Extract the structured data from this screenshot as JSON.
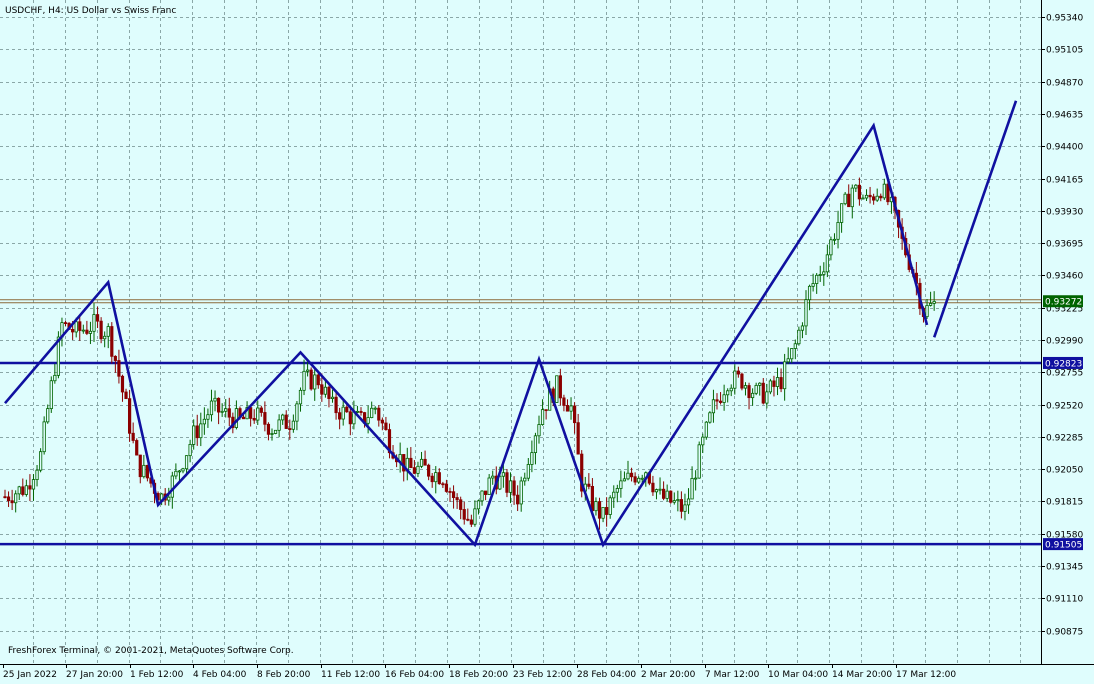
{
  "header": {
    "title": "USDCHF, H4:  US Dollar vs Swiss Franc"
  },
  "footer": {
    "copyright": "FreshForex Terminal, © 2001-2021, MetaQuotes Software Corp."
  },
  "colors": {
    "background": "#dffdfd",
    "grid": "#8aa7a7",
    "bull": "#006400",
    "bear": "#8b0000",
    "line": "#1010a0",
    "price_line": "#8b6a3a",
    "current_badge": "#006400",
    "level_badge": "#1010a0"
  },
  "chart_data": {
    "type": "candlestick",
    "symbol": "USDCHF",
    "timeframe": "H4",
    "y_ticks": [
      "0.95340",
      "0.95105",
      "0.94870",
      "0.94635",
      "0.94400",
      "0.94165",
      "0.93930",
      "0.93695",
      "0.93460",
      "0.93225",
      "0.92990",
      "0.92755",
      "0.92520",
      "0.92285",
      "0.92050",
      "0.91815",
      "0.91580",
      "0.91345",
      "0.91110",
      "0.90875"
    ],
    "x_ticks": [
      "25 Jan 2022",
      "27 Jan 20:00",
      "1 Feb 12:00",
      "4 Feb 04:00",
      "8 Feb 20:00",
      "11 Feb 12:00",
      "16 Feb 04:00",
      "18 Feb 20:00",
      "23 Feb 12:00",
      "28 Feb 04:00",
      "2 Mar 20:00",
      "7 Mar 12:00",
      "10 Mar 04:00",
      "14 Mar 20:00",
      "17 Mar 12:00"
    ],
    "ylim": [
      0.907,
      0.9545
    ],
    "current_price": {
      "label": "0.93272",
      "value": 0.93272
    },
    "horizontal_levels": [
      {
        "label": "0.92823",
        "value": 0.92823
      },
      {
        "label": "0.91505",
        "value": 0.91505
      }
    ],
    "zigzag": [
      {
        "x": 0,
        "y": 0.9253
      },
      {
        "x": 29,
        "y": 0.9341
      },
      {
        "x": 43,
        "y": 0.9179
      },
      {
        "x": 83,
        "y": 0.929
      },
      {
        "x": 132,
        "y": 0.915
      },
      {
        "x": 150,
        "y": 0.9285
      },
      {
        "x": 168,
        "y": 0.915
      },
      {
        "x": 244,
        "y": 0.9455
      },
      {
        "x": 259,
        "y": 0.931
      }
    ],
    "projection": [
      {
        "x": 261,
        "y": 0.9301
      },
      {
        "x": 284,
        "y": 0.9473
      }
    ],
    "candle_anchors": [
      {
        "x": 0,
        "y": 0.9185
      },
      {
        "x": 6,
        "y": 0.9192
      },
      {
        "x": 10,
        "y": 0.9215
      },
      {
        "x": 13,
        "y": 0.9265
      },
      {
        "x": 16,
        "y": 0.931
      },
      {
        "x": 20,
        "y": 0.9305
      },
      {
        "x": 25,
        "y": 0.931
      },
      {
        "x": 29,
        "y": 0.9305
      },
      {
        "x": 31,
        "y": 0.9285
      },
      {
        "x": 34,
        "y": 0.925
      },
      {
        "x": 37,
        "y": 0.921
      },
      {
        "x": 41,
        "y": 0.9195
      },
      {
        "x": 44,
        "y": 0.9185
      },
      {
        "x": 48,
        "y": 0.92
      },
      {
        "x": 53,
        "y": 0.923
      },
      {
        "x": 58,
        "y": 0.925
      },
      {
        "x": 62,
        "y": 0.9245
      },
      {
        "x": 66,
        "y": 0.924
      },
      {
        "x": 70,
        "y": 0.9245
      },
      {
        "x": 75,
        "y": 0.9235
      },
      {
        "x": 80,
        "y": 0.924
      },
      {
        "x": 84,
        "y": 0.927
      },
      {
        "x": 88,
        "y": 0.927
      },
      {
        "x": 92,
        "y": 0.925
      },
      {
        "x": 96,
        "y": 0.9245
      },
      {
        "x": 100,
        "y": 0.924
      },
      {
        "x": 104,
        "y": 0.925
      },
      {
        "x": 108,
        "y": 0.9225
      },
      {
        "x": 113,
        "y": 0.9205
      },
      {
        "x": 118,
        "y": 0.9205
      },
      {
        "x": 123,
        "y": 0.92
      },
      {
        "x": 127,
        "y": 0.918
      },
      {
        "x": 131,
        "y": 0.9165
      },
      {
        "x": 134,
        "y": 0.9185
      },
      {
        "x": 137,
        "y": 0.92
      },
      {
        "x": 140,
        "y": 0.9195
      },
      {
        "x": 144,
        "y": 0.9185
      },
      {
        "x": 148,
        "y": 0.9225
      },
      {
        "x": 151,
        "y": 0.925
      },
      {
        "x": 155,
        "y": 0.9265
      },
      {
        "x": 159,
        "y": 0.925
      },
      {
        "x": 162,
        "y": 0.9195
      },
      {
        "x": 165,
        "y": 0.918
      },
      {
        "x": 168,
        "y": 0.917
      },
      {
        "x": 172,
        "y": 0.919
      },
      {
        "x": 176,
        "y": 0.92
      },
      {
        "x": 180,
        "y": 0.9205
      },
      {
        "x": 184,
        "y": 0.9185
      },
      {
        "x": 188,
        "y": 0.918
      },
      {
        "x": 191,
        "y": 0.9175
      },
      {
        "x": 195,
        "y": 0.9215
      },
      {
        "x": 199,
        "y": 0.925
      },
      {
        "x": 203,
        "y": 0.927
      },
      {
        "x": 207,
        "y": 0.927
      },
      {
        "x": 211,
        "y": 0.926
      },
      {
        "x": 214,
        "y": 0.926
      },
      {
        "x": 218,
        "y": 0.927
      },
      {
        "x": 222,
        "y": 0.9295
      },
      {
        "x": 226,
        "y": 0.9335
      },
      {
        "x": 230,
        "y": 0.9355
      },
      {
        "x": 234,
        "y": 0.9385
      },
      {
        "x": 238,
        "y": 0.941
      },
      {
        "x": 242,
        "y": 0.94
      },
      {
        "x": 246,
        "y": 0.941
      },
      {
        "x": 249,
        "y": 0.9395
      },
      {
        "x": 252,
        "y": 0.937
      },
      {
        "x": 255,
        "y": 0.935
      },
      {
        "x": 258,
        "y": 0.932
      },
      {
        "x": 261,
        "y": 0.9325
      }
    ]
  }
}
